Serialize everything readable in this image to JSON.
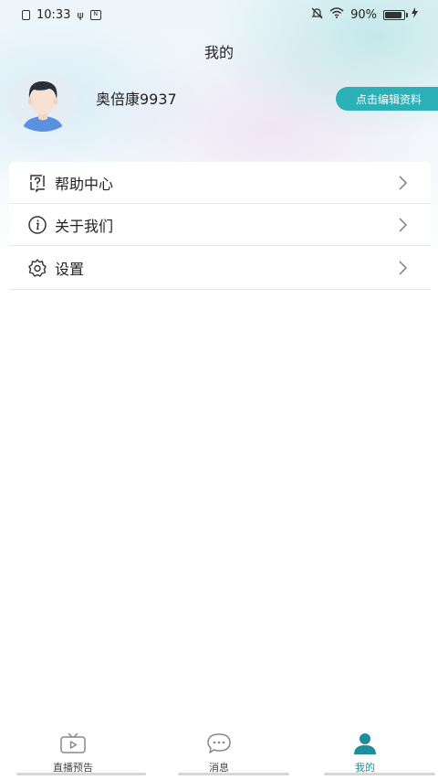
{
  "status_bar": {
    "time": "10:33",
    "battery": "90%"
  },
  "header": {
    "title": "我的"
  },
  "profile": {
    "username": "奥倍康9937",
    "edit_label": "点击编辑资料"
  },
  "menu": {
    "items": [
      {
        "label": "帮助中心",
        "icon": "help-icon"
      },
      {
        "label": "关于我们",
        "icon": "info-icon"
      },
      {
        "label": "设置",
        "icon": "settings-icon"
      }
    ]
  },
  "tabbar": {
    "tabs": [
      {
        "label": "直播预告",
        "icon": "tv-icon",
        "active": false
      },
      {
        "label": "消息",
        "icon": "chat-icon",
        "active": false
      },
      {
        "label": "我的",
        "icon": "person-icon",
        "active": true
      }
    ]
  },
  "colors": {
    "accent": "#2bb0b7",
    "active_tab": "#1e8f98"
  }
}
